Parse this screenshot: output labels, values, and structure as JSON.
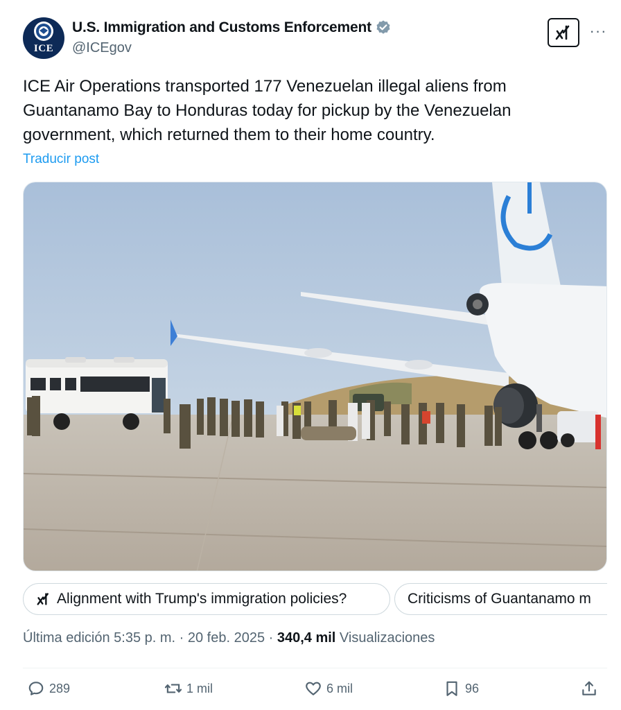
{
  "author": {
    "display_name": "U.S. Immigration and Customs Enforcement",
    "handle": "@ICEgov",
    "avatar_text": "ICE",
    "verified": true
  },
  "post": {
    "text": "ICE Air Operations transported 177 Venezuelan illegal aliens from Guantanamo Bay to Honduras today for pickup by the Venezuelan government, which returned them to their home country.",
    "translate_label": "Traducir post"
  },
  "chips": [
    {
      "label": "Alignment with Trump's immigration policies?",
      "icon": "grok-icon"
    },
    {
      "label": "Criticisms of Guantanamo m"
    }
  ],
  "meta": {
    "edited_label": "Última edición 5:35 p. m. · 20 feb. 2025 · ",
    "views_count": "340,4 mil",
    "views_label": " Visualizaciones"
  },
  "actions": {
    "replies": "289",
    "reposts": "1 mil",
    "likes": "6 mil",
    "bookmarks": "96"
  },
  "icons": {
    "verified": "verified-badge-icon",
    "grok": "grok-icon",
    "more": "more-icon",
    "reply": "reply-icon",
    "repost": "repost-icon",
    "like": "like-icon",
    "bookmark": "bookmark-icon",
    "share": "share-icon"
  },
  "colors": {
    "accent": "#1d9bf0",
    "muted": "#536471",
    "text": "#0f1419",
    "avatar_bg": "#0d2a57"
  }
}
